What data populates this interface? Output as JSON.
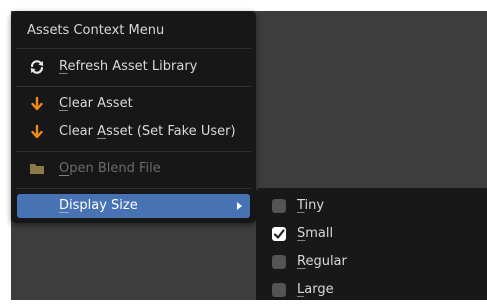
{
  "menu": {
    "title": "Assets Context Menu",
    "items": [
      {
        "label_first": "R",
        "label_rest": "efresh Asset Library",
        "icon": "refresh-icon",
        "enabled": true
      },
      {
        "label_first": "C",
        "label_rest": "lear Asset",
        "icon": "down-arrow-icon",
        "enabled": true
      },
      {
        "label_pre": "Clear ",
        "label_mid": "A",
        "label_rest": "sset (Set Fake User)",
        "icon": "down-arrow-icon",
        "enabled": true
      },
      {
        "label_first": "O",
        "label_rest": "pen Blend File",
        "icon": "folder-icon",
        "enabled": false
      },
      {
        "label_first": "D",
        "label_rest": "isplay Size",
        "icon": "submenu-arrow-icon",
        "enabled": true,
        "highlighted": true
      }
    ]
  },
  "submenu": {
    "items": [
      {
        "label_first": "T",
        "label_rest": "iny",
        "checked": false
      },
      {
        "label_first": "S",
        "label_rest": "mall",
        "checked": true
      },
      {
        "label_first": "R",
        "label_rest": "egular",
        "checked": false
      },
      {
        "label_first": "L",
        "label_rest": "arge",
        "checked": false
      }
    ]
  },
  "colors": {
    "menu_bg": "#171717",
    "highlight": "#4772b3",
    "orange_icon": "#f08a1c",
    "folder_icon": "#8a7a48",
    "disabled_text": "#6a6a6a"
  }
}
